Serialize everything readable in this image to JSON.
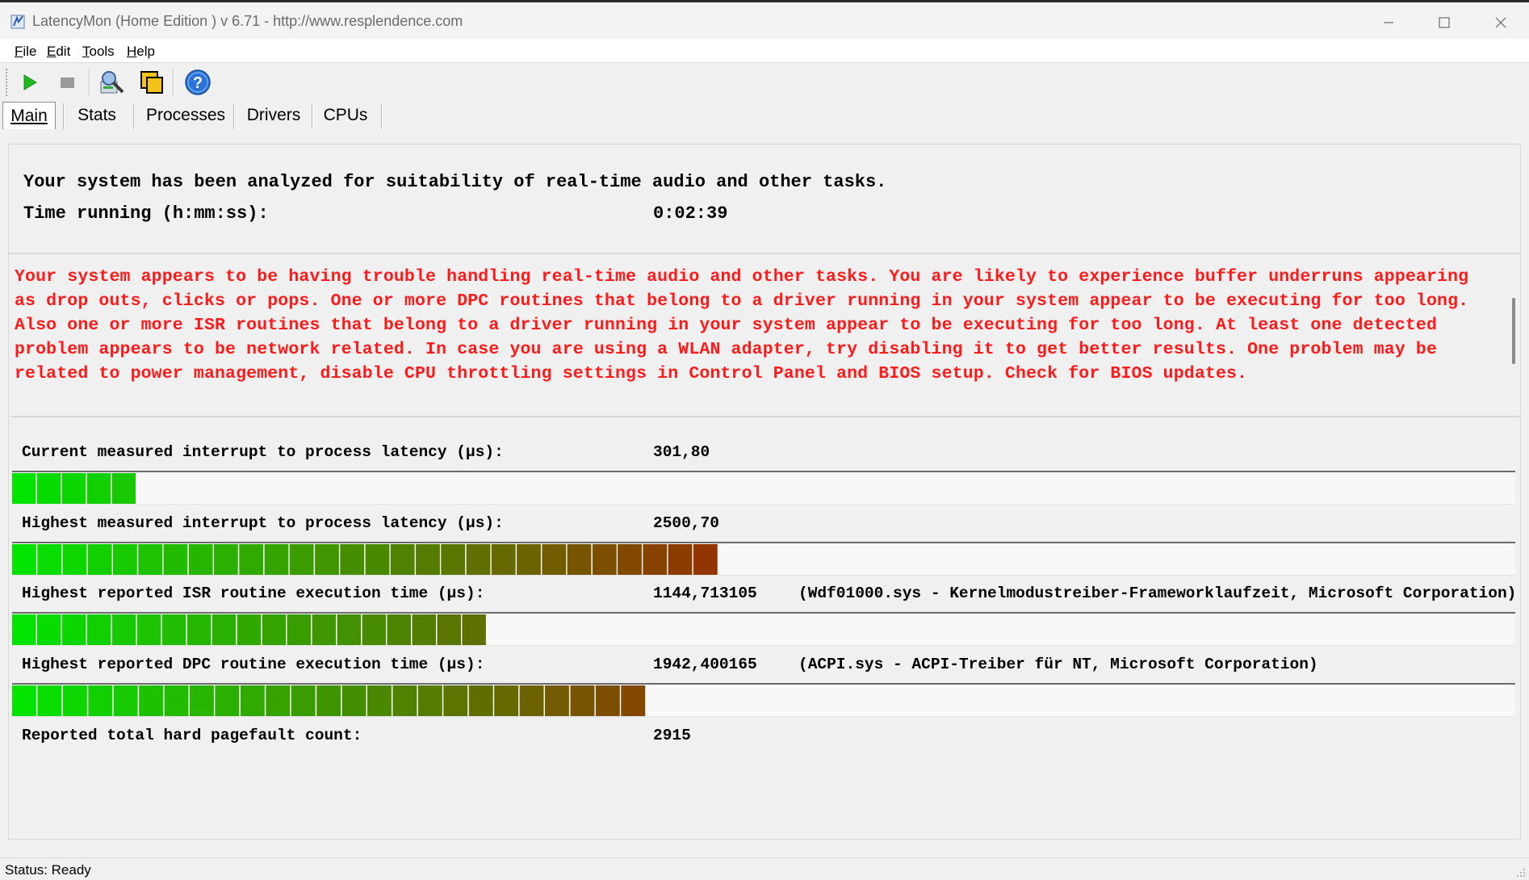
{
  "window": {
    "title": "LatencyMon  (Home Edition )  v 6.71 - http://www.resplendence.com"
  },
  "menu": [
    {
      "label": "File",
      "mnemonic": "F",
      "rest": "ile"
    },
    {
      "label": "Edit",
      "mnemonic": "E",
      "rest": "dit"
    },
    {
      "label": "Tools",
      "mnemonic": "T",
      "rest": "ools"
    },
    {
      "label": "Help",
      "mnemonic": "H",
      "rest": "elp"
    }
  ],
  "toolbar": {
    "icons": [
      "play-icon",
      "stop-icon",
      "analyze-icon",
      "windows-icon",
      "help-icon"
    ],
    "colors": {
      "play": "#22b822",
      "stop": "#9a9a9a",
      "help": "#2a73d9"
    }
  },
  "tabs": {
    "main": "Main",
    "stats": "Stats",
    "processes": "Processes",
    "drivers": "Drivers",
    "cpus": "CPUs",
    "active": "Main"
  },
  "summary": {
    "headline": "Your system has been analyzed for suitability of real-time audio and other tasks.",
    "time_label": "Time running (h:mm:ss):",
    "time_value": "0:02:39"
  },
  "message": {
    "text": "Your system appears to be having trouble handling real-time audio and other tasks. You are likely to experience buffer underruns appearing as drop outs, clicks or pops. One or more DPC routines that belong to a driver running in your system appear to be executing for too long. Also one or more ISR routines that belong to a driver running in your system appear to be executing for too long. At least one detected problem appears to be network related. In case you are using a WLAN adapter, try disabling it to get better results. One problem may be related to power management, disable CPU throttling settings in Control Panel and BIOS setup. Check for BIOS updates.",
    "color": "#ff1a1a"
  },
  "metrics": {
    "current": {
      "label": "Current measured interrupt to process latency (µs):",
      "value": "301,80",
      "extra": "",
      "level": 0.083
    },
    "highest": {
      "label": "Highest measured interrupt to process latency (µs):",
      "value": "2500,70",
      "extra": "",
      "level": 0.47
    },
    "isr": {
      "label": "Highest reported ISR routine execution time (µs):",
      "value": "1144,713105",
      "extra": "(Wdf01000.sys - Kernelmodustreiber-Frameworklaufzeit, Microsoft Corporation)",
      "level": 0.316
    },
    "dpc": {
      "label": "Highest reported DPC routine execution time (µs):",
      "value": "1942,400165",
      "extra": "(ACPI.sys - ACPI-Treiber für NT, Microsoft Corporation)",
      "level": 0.422
    },
    "pagefault": {
      "label": "Reported total hard pagefault count:",
      "value": "2915"
    }
  },
  "status": {
    "text": "Status: Ready"
  }
}
